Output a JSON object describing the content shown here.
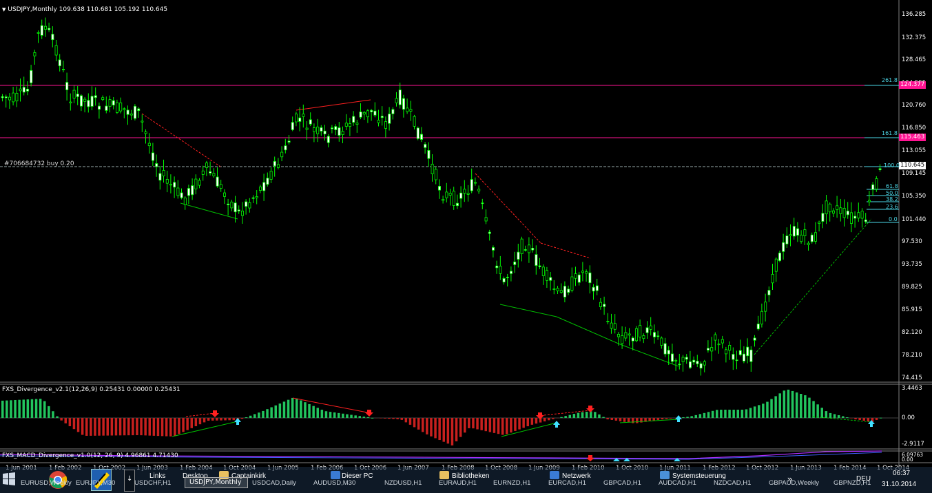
{
  "main_chart": {
    "info": "USDJPY,Monthly  109.638 110.681 105.192 110.645",
    "order_label": "#706684732 buy 0.20",
    "price_labels": [
      "136.285",
      "132.375",
      "128.465",
      "124.555",
      "120.760",
      "116.850",
      "113.055",
      "109.145",
      "105.350",
      "101.440",
      "97.530",
      "93.735",
      "89.825",
      "85.915",
      "82.120",
      "78.210",
      "74.415"
    ],
    "boxes": {
      "fib_261": "124.377",
      "fib_161": "115.463",
      "bid": "110.645"
    },
    "fib_levels": [
      "261.8",
      "161.8",
      "100.0",
      "61.8",
      "50.0",
      "38.2",
      "23.6",
      "0.0"
    ]
  },
  "indicator1": {
    "info": "FXS_Divergence_v2.1(12,26,9) 0.25431 0.00000 0.25431",
    "levels": [
      "3.4463",
      "0.00",
      "-2.9117"
    ]
  },
  "indicator2": {
    "info": "FXS_MACD_Divergence_v1.0(12, 26, 9) 4.96861 4.71430",
    "levels": [
      "6.09763",
      "0.00"
    ]
  },
  "date_axis": [
    "1 Jun 2001",
    "1 Feb 2002",
    "1 Oct 2002",
    "1 Jun 2003",
    "1 Feb 2004",
    "1 Oct 2004",
    "1 Jun 2005",
    "1 Feb 2006",
    "1 Oct 2006",
    "1 Jun 2007",
    "1 Feb 2008",
    "1 Oct 2008",
    "1 Jun 2009",
    "1 Feb 2010",
    "1 Oct 2010",
    "1 Jun 2011",
    "1 Feb 2012",
    "1 Oct 2012",
    "1 Jun 2013",
    "1 Feb 2014",
    "1 Oct 2014"
  ],
  "taskbar": {
    "links": "Links",
    "desktop": "Desktop",
    "folders": [
      "Captainkirk",
      "Dieser PC",
      "Bibliotheken",
      "Netzwerk",
      "Systemsteuerung"
    ],
    "chart_tabs": [
      "EURUSD,Weekly",
      "EURJPY,M30",
      "USDCHF,H1",
      "USDJPY,Monthly",
      "USDCAD,Daily",
      "AUDUSD,M30",
      "NZDUSD,H1",
      "EURAUD,H1",
      "EURNZD,H1",
      "EURCAD,H1",
      "GBPCAD,H1",
      "AUDCAD,H1",
      "NZDCAD,H1",
      "GBPAUD,Weekly",
      "GBPNZD,H1"
    ],
    "chevron": "»",
    "language": "DEU",
    "time": "06:37",
    "date": "31.10.2014"
  },
  "colors": {
    "bull": "#00ff00",
    "bear": "#00ff00",
    "fib_line": "#ff1493",
    "hist_up": "#22c55e",
    "hist_down": "#c8201e",
    "background": "#000000"
  }
}
